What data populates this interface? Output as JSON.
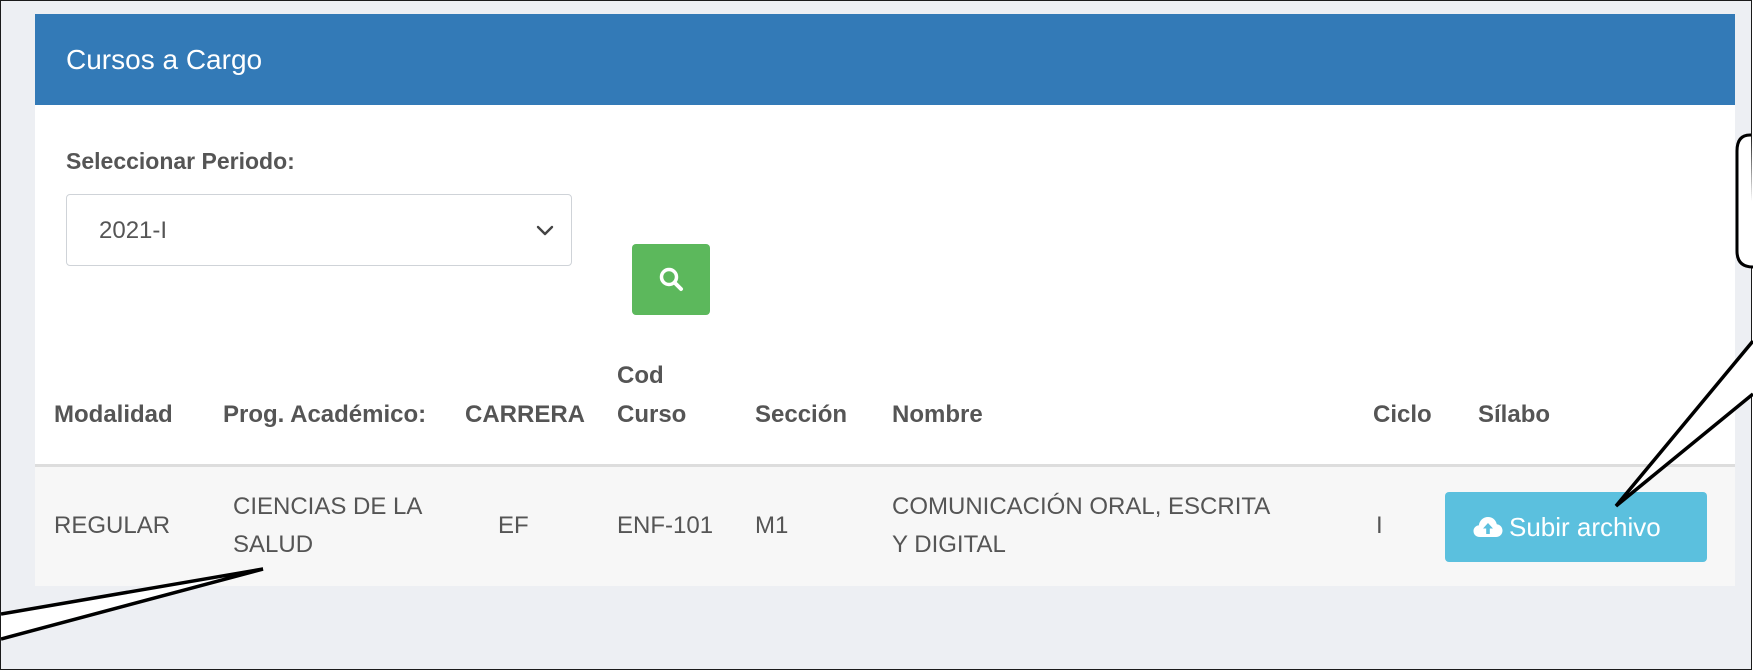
{
  "panel": {
    "title": "Cursos a Cargo"
  },
  "filter": {
    "label": "Seleccionar Periodo:",
    "selected_period": "2021-I",
    "search_icon": "search-icon"
  },
  "table": {
    "headers": {
      "modalidad": "Modalidad",
      "programa": "Prog. Académico:",
      "carrera": "CARRERA",
      "cod_curso_line1": "Cod",
      "cod_curso_line2": "Curso",
      "seccion": "Sección",
      "nombre": "Nombre",
      "ciclo": "Ciclo",
      "silabo": "Sílabo"
    },
    "rows": [
      {
        "modalidad": "REGULAR",
        "programa_line1": "CIENCIAS DE LA",
        "programa_line2": "SALUD",
        "carrera": "EF",
        "cod_curso": "ENF-101",
        "seccion": "M1",
        "nombre_line1": "COMUNICACIÓN ORAL, ESCRITA",
        "nombre_line2": "Y DIGITAL",
        "ciclo": "I",
        "upload_label": "Subir archivo",
        "upload_icon": "cloud-upload-icon"
      }
    ]
  },
  "colors": {
    "header_blue": "#337ab7",
    "search_green": "#5cb85c",
    "upload_cyan": "#5bc0de",
    "page_bg": "#edeff3"
  }
}
